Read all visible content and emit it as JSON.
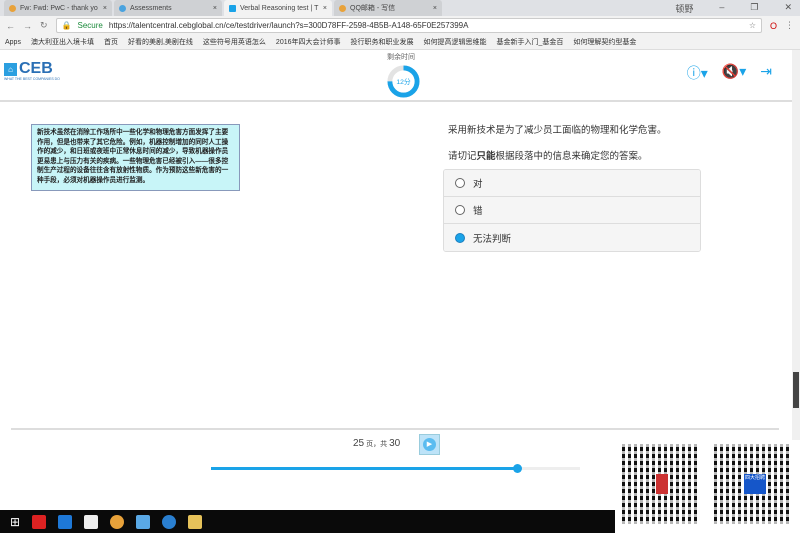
{
  "browser": {
    "tabs": [
      {
        "label": "Fw: Fwd: PwC - thank yo"
      },
      {
        "label": "Assessments"
      },
      {
        "label": "Verbal Reasoning test | T"
      },
      {
        "label": "QQ邮箱 - 写信"
      }
    ],
    "user": "顿野",
    "secure_label": "Secure",
    "url": "https://talentcentral.cebglobal.cn/ce/testdriver/launch?s=300D78FF-2598-4B5B-A148-65F0E257399A",
    "bookmarks": [
      "Apps",
      "澳大利亚出入境卡填",
      "首页",
      "好看的美剧,美剧在线",
      "这些符号用英语怎么",
      "2016年四大会计师事",
      "投行职务和职业发展",
      "如何提高逻辑思维能",
      "基金新手入门_基金百",
      "如何理解契约型基金"
    ]
  },
  "header": {
    "logo": "CEB",
    "tagline": "WHAT THE BEST COMPANIES DO",
    "timer_label": "剩余时间",
    "timer_value": "12分",
    "timer_fraction": 0.75
  },
  "passage": "新技术虽然在消除工作场所中一些化学和物理危害方面发挥了主要作用，但是也带来了其它危险。例如，机器控制增加的同时人工操作的减少，和日班或夜班中正常休息时间的减少，导致机器操作员更易患上与压力有关的疾病。一些物理危害已经被引入——很多控制生产过程的设备往往含有放射性物质。作为预防这些新危害的一种手段，必须对机器操作员进行监测。",
  "question": {
    "statement": "采用新技术是为了减少员工面临的物理和化学危害。",
    "instruction_pre": "请切记",
    "instruction_bold": "只能",
    "instruction_post": "根据段落中的信息来确定您的答案。",
    "options": [
      {
        "label": "对",
        "selected": false
      },
      {
        "label": "错",
        "selected": false
      },
      {
        "label": "无法判断",
        "selected": true
      }
    ]
  },
  "pager": {
    "current": "25",
    "page_word": "页，共",
    "total": "30",
    "progress": 0.83
  },
  "qr": {
    "badge2": "四大招聘"
  },
  "colors": {
    "accent": "#1aa3e8",
    "passage_bg": "#c8f5f8"
  }
}
